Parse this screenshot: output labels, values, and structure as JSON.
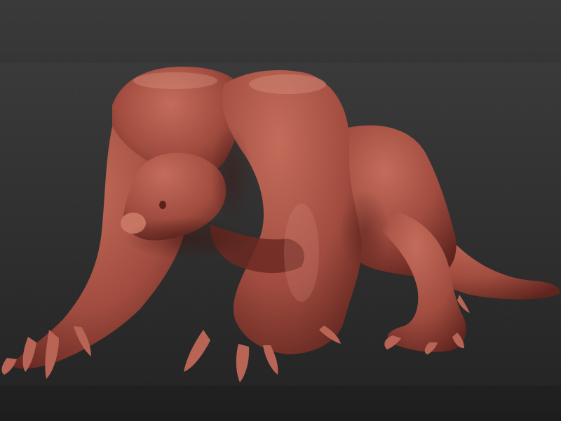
{
  "scene": {
    "background_top": "#3a3a3a",
    "background_mid": "#2b2b2b",
    "background_bottom": "#1e1e1e",
    "clay_light": "#c46a58",
    "clay_mid": "#a0483b",
    "clay_dark": "#5e2019",
    "clay_shadow": "#3a100c",
    "claw_color": "#b86252"
  }
}
